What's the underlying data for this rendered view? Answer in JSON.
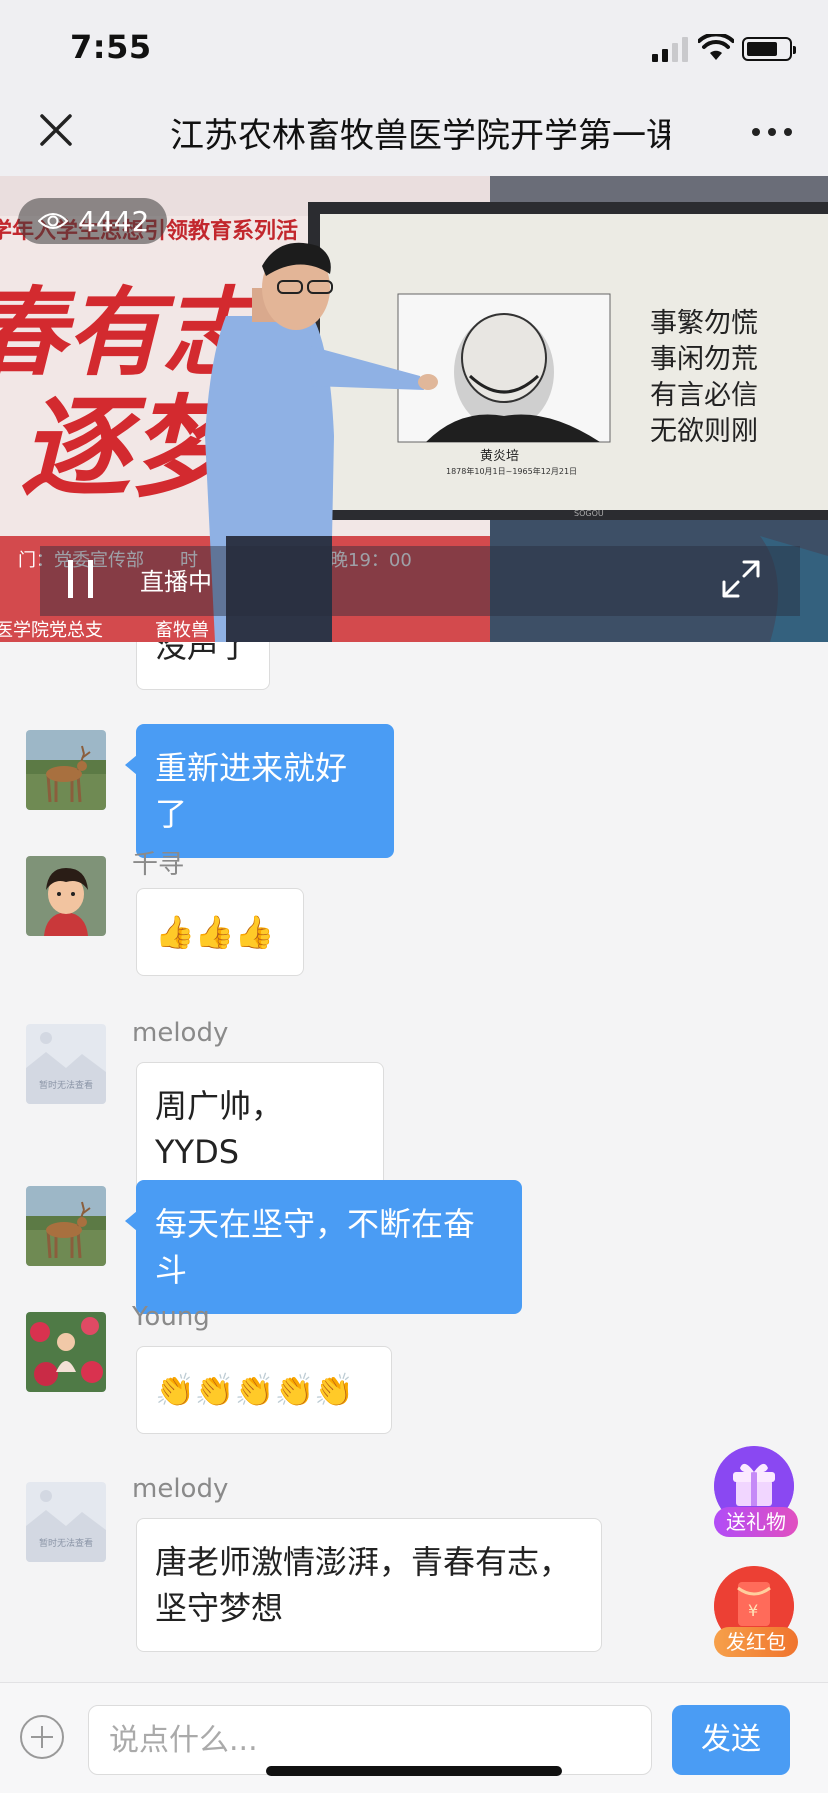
{
  "status": {
    "time": "7:55"
  },
  "nav": {
    "title": "江苏农林畜牧兽医学院开学第一课"
  },
  "video": {
    "viewers": "4442",
    "live_label": "直播中",
    "banner_lines": [
      "学年入学生思想引领教育系列活",
      "春有志",
      "逐梦",
      "门：党委宣传部",
      "时",
      "晚19：00",
      "医学院党总支",
      "畜牧兽"
    ],
    "slide": {
      "portrait_name": "黄炎培",
      "portrait_dates": "1878年10月1日~1965年12月21日",
      "poem": [
        "事繁勿慌",
        "事闲勿荒",
        "有言必信",
        "无欲则刚"
      ],
      "tv_brand": "SOGOU"
    }
  },
  "chat": {
    "messages": [
      {
        "sender": "",
        "text": "没声了",
        "self": false,
        "avatar": "none"
      },
      {
        "sender": "",
        "text": "重新进来就好了",
        "self": true,
        "avatar": "deer-photo"
      },
      {
        "sender": "千寻",
        "text": "👍👍👍",
        "self": false,
        "avatar": "cartoon-boy"
      },
      {
        "sender": "melody",
        "text": "周广帅，YYDS",
        "self": false,
        "avatar": "placeholder",
        "avatar_text": "暂时无法查看"
      },
      {
        "sender": "",
        "text": "每天在坚守，不断在奋斗",
        "self": true,
        "avatar": "deer-photo"
      },
      {
        "sender": "Young",
        "text": "👏👏👏👏👏",
        "self": false,
        "avatar": "flower-photo"
      },
      {
        "sender": "melody",
        "text": "唐老师激情澎湃，青春有志，坚守梦想",
        "self": false,
        "avatar": "placeholder",
        "avatar_text": "暂时无法查看"
      }
    ]
  },
  "actions": {
    "gift_label": "送礼物",
    "redpacket_label": "发红包",
    "redpacket_symbol": "¥"
  },
  "composer": {
    "placeholder": "说点什么...",
    "send_label": "发送"
  }
}
